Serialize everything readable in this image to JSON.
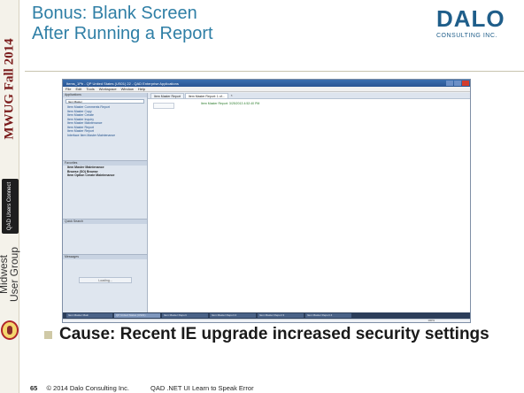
{
  "side": {
    "event": "MWUG Fall 2014",
    "badge_lines": [
      "QAD",
      "Users",
      "Connect"
    ],
    "group_lines": [
      "Midwest",
      "User Group"
    ]
  },
  "title_lines": [
    "Bonus: Blank Screen",
    "After Running a Report"
  ],
  "brand": {
    "name": "DALO",
    "tagline": "CONSULTING INC."
  },
  "app": {
    "window_title": "Items_1Pb - QP United States (US01) 22 - QAD Enterprise Applications",
    "menus": [
      "File",
      "Edit",
      "Tools",
      "Workspace",
      "Window",
      "Help"
    ],
    "left": {
      "applications_header": "Applications",
      "combo_value": "Item Master",
      "links": [
        "Item Master Comments Report",
        "Item Master Copy",
        "Item Master Create",
        "Item Master Inquiry",
        "Item Master Maintenance",
        "Item Master Report",
        "Item Master Report",
        "Interface Item Master Maintenance"
      ],
      "favorites_header": "Favorites",
      "favorites": [
        "Item Master Maintenance",
        "Browse (SO) Browse",
        "Item Option Create Maintenance"
      ],
      "quick_search_header": "Quick Search",
      "messages_header": "Messages",
      "loading_label": "Loading..."
    },
    "tabs": [
      "Item Master Report",
      "Item Master Report: 1 of..."
    ],
    "report_hint": "Item Master Report: 3/25/2013 4:52:40 PM",
    "taskbar": [
      "Item Master Main",
      "QP United States (US01)",
      "Item Master Report",
      "Item Master Report 2",
      "Item Master Report 3",
      "Item Master Report 4"
    ],
    "zoom": "100%"
  },
  "bullet": "Cause: Recent IE upgrade increased security settings",
  "footer": {
    "page": "65",
    "copyright": "© 2014 Dalo Consulting Inc.",
    "center": "QAD .NET UI Learn to Speak Error"
  },
  "colors": {
    "title": "#2f7fa6",
    "brand": "#1f5e8a",
    "event": "#7a1b1b"
  }
}
